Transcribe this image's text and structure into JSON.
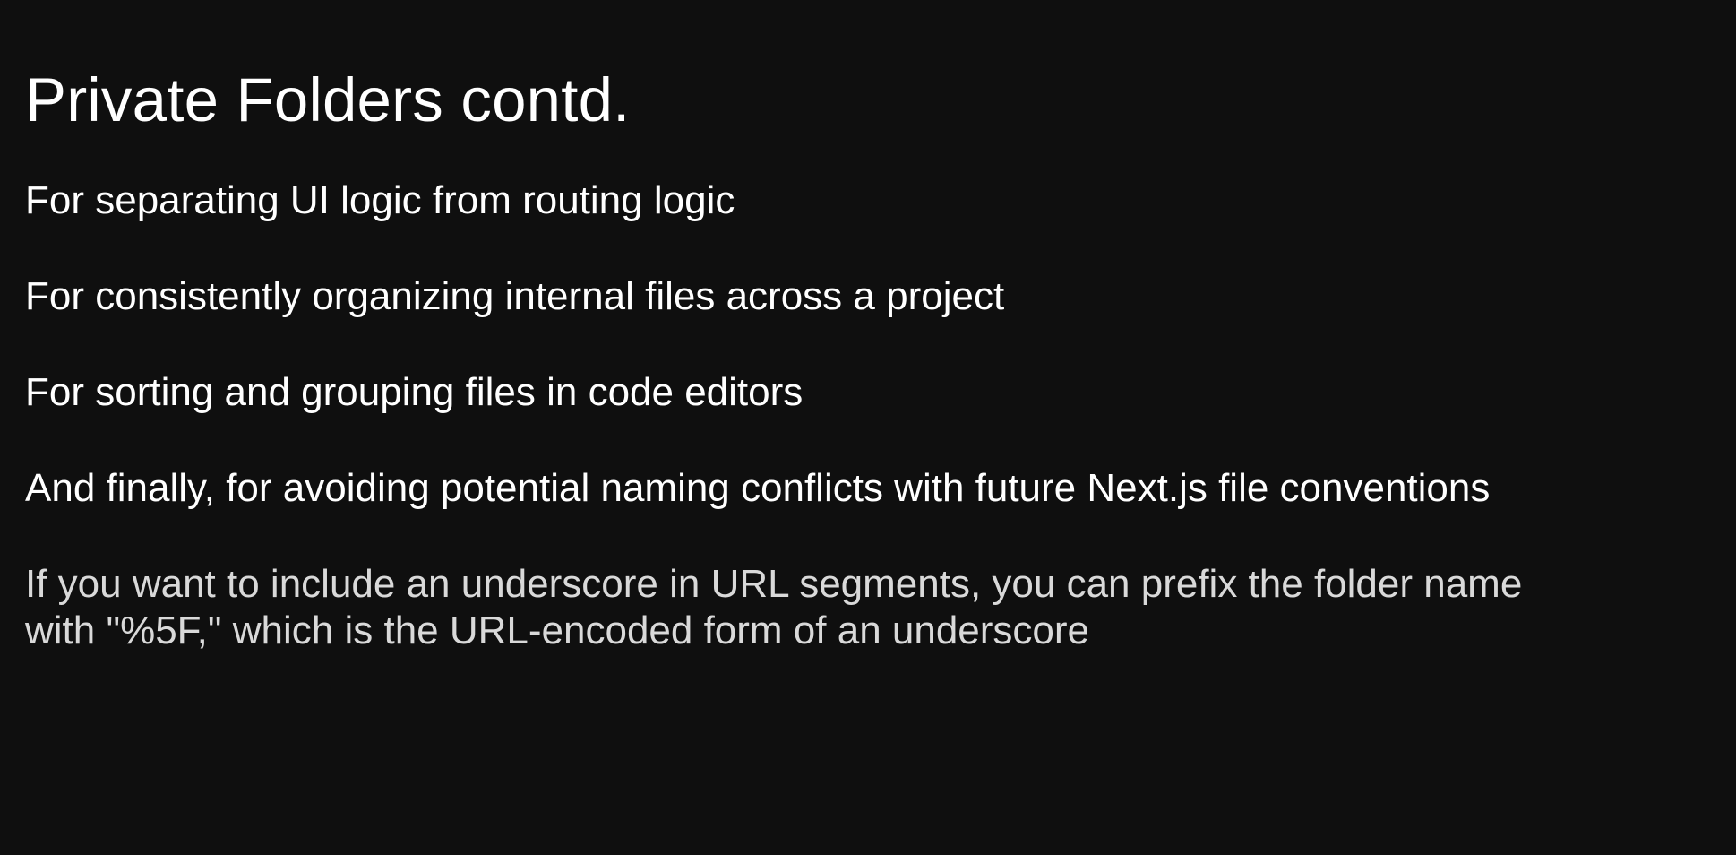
{
  "slide": {
    "title": "Private Folders contd.",
    "points": [
      "For separating UI logic from routing logic",
      "For consistently organizing internal files across a project",
      "For sorting and grouping files in code editors",
      "And finally, for avoiding potential naming conflicts with future Next.js file conventions",
      "If you want to include an underscore in URL segments, you can prefix the folder name with \"%5F,\" which is the URL-encoded form of an underscore"
    ],
    "colors": {
      "background": "#0f0f0f",
      "text": "#ffffff",
      "muted_text": "#d9d9d9"
    }
  }
}
